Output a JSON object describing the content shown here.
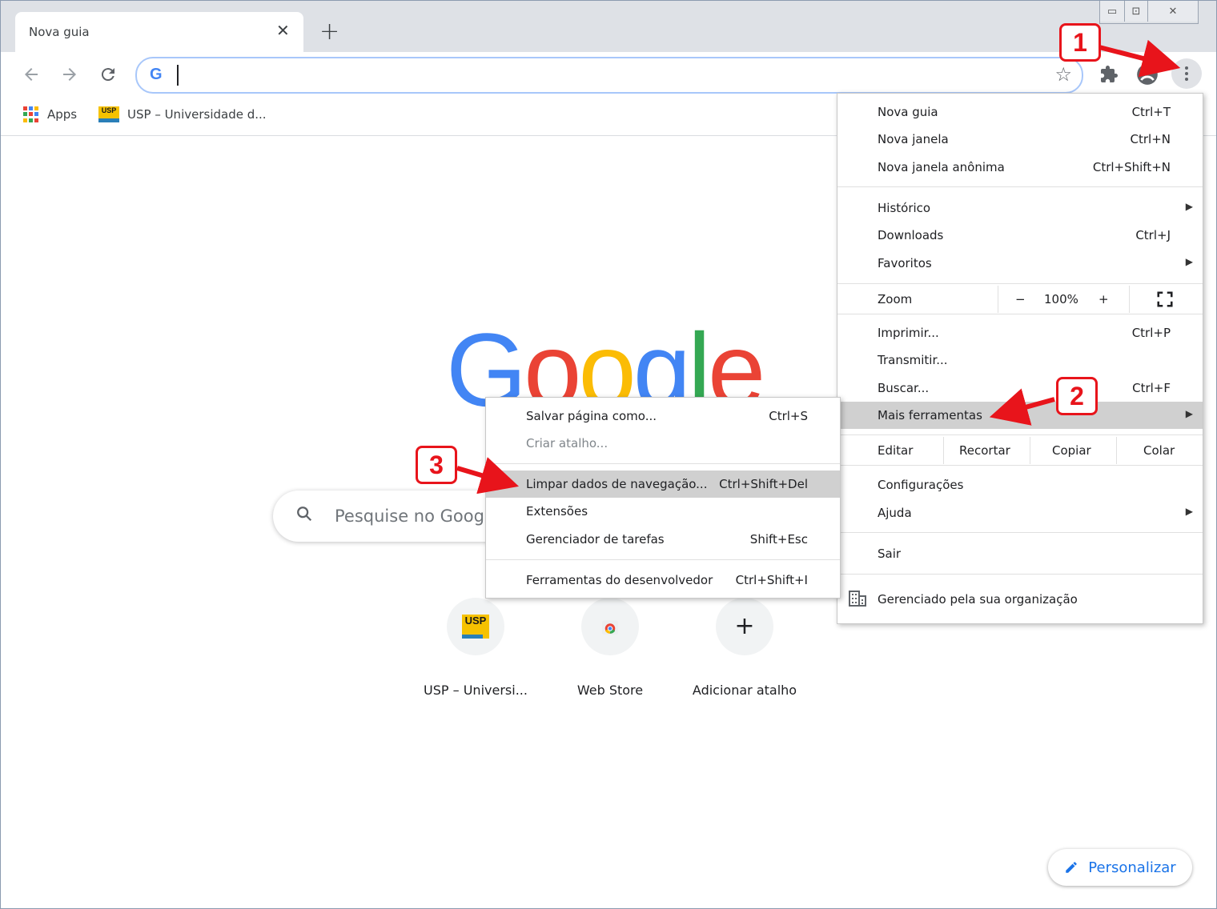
{
  "tab": {
    "title": "Nova guia",
    "close": "✕",
    "new_tab": "+"
  },
  "window_controls": {
    "minimize": "▭",
    "restore": "⊡",
    "close": "✕"
  },
  "omnibox": {
    "value": ""
  },
  "bookmarks": [
    {
      "label": "Apps",
      "icon": "apps-grid-icon"
    },
    {
      "label": "USP – Universidade d...",
      "icon": "usp-favicon",
      "favicon_text": "USP"
    }
  ],
  "google_logo": {
    "letters": [
      "G",
      "o",
      "o",
      "g",
      "l",
      "e"
    ],
    "colors": [
      "#4285f4",
      "#ea4335",
      "#fbbc05",
      "#4285f4",
      "#34a853",
      "#ea4335"
    ]
  },
  "search": {
    "placeholder": "Pesquise no Google"
  },
  "shortcuts": [
    {
      "label": "USP – Universi...",
      "icon_text": "USP"
    },
    {
      "label": "Web Store"
    },
    {
      "label": "Adicionar atalho",
      "icon_text": "+"
    }
  ],
  "personalize": {
    "label": "Personalizar"
  },
  "main_menu": {
    "new_tab": {
      "label": "Nova guia",
      "shortcut": "Ctrl+T"
    },
    "new_window": {
      "label": "Nova janela",
      "shortcut": "Ctrl+N"
    },
    "incognito": {
      "label": "Nova janela anônima",
      "shortcut": "Ctrl+Shift+N"
    },
    "history": {
      "label": "Histórico"
    },
    "downloads": {
      "label": "Downloads",
      "shortcut": "Ctrl+J"
    },
    "favorites": {
      "label": "Favoritos"
    },
    "zoom": {
      "label": "Zoom",
      "minus": "−",
      "value": "100%",
      "plus": "+"
    },
    "print": {
      "label": "Imprimir...",
      "shortcut": "Ctrl+P"
    },
    "cast": {
      "label": "Transmitir..."
    },
    "find": {
      "label": "Buscar...",
      "shortcut": "Ctrl+F"
    },
    "more_tools": {
      "label": "Mais ferramentas"
    },
    "edit": {
      "label": "Editar",
      "cut": "Recortar",
      "copy": "Copiar",
      "paste": "Colar"
    },
    "settings": {
      "label": "Configurações"
    },
    "help": {
      "label": "Ajuda"
    },
    "exit": {
      "label": "Sair"
    },
    "managed": {
      "label": "Gerenciado pela sua organização"
    }
  },
  "submenu": {
    "save_page": {
      "label": "Salvar página como...",
      "shortcut": "Ctrl+S"
    },
    "create_shortcut": {
      "label": "Criar atalho..."
    },
    "clear_data": {
      "label": "Limpar dados de navegação...",
      "shortcut": "Ctrl+Shift+Del"
    },
    "extensions": {
      "label": "Extensões"
    },
    "task_manager": {
      "label": "Gerenciador de tarefas",
      "shortcut": "Shift+Esc"
    },
    "dev_tools": {
      "label": "Ferramentas do desenvolvedor",
      "shortcut": "Ctrl+Shift+I"
    }
  },
  "callouts": [
    "1",
    "2",
    "3"
  ],
  "colors": {
    "accent": "#1a73e8",
    "callout_red": "#e8141b",
    "highlight": "#d0d0d0"
  }
}
